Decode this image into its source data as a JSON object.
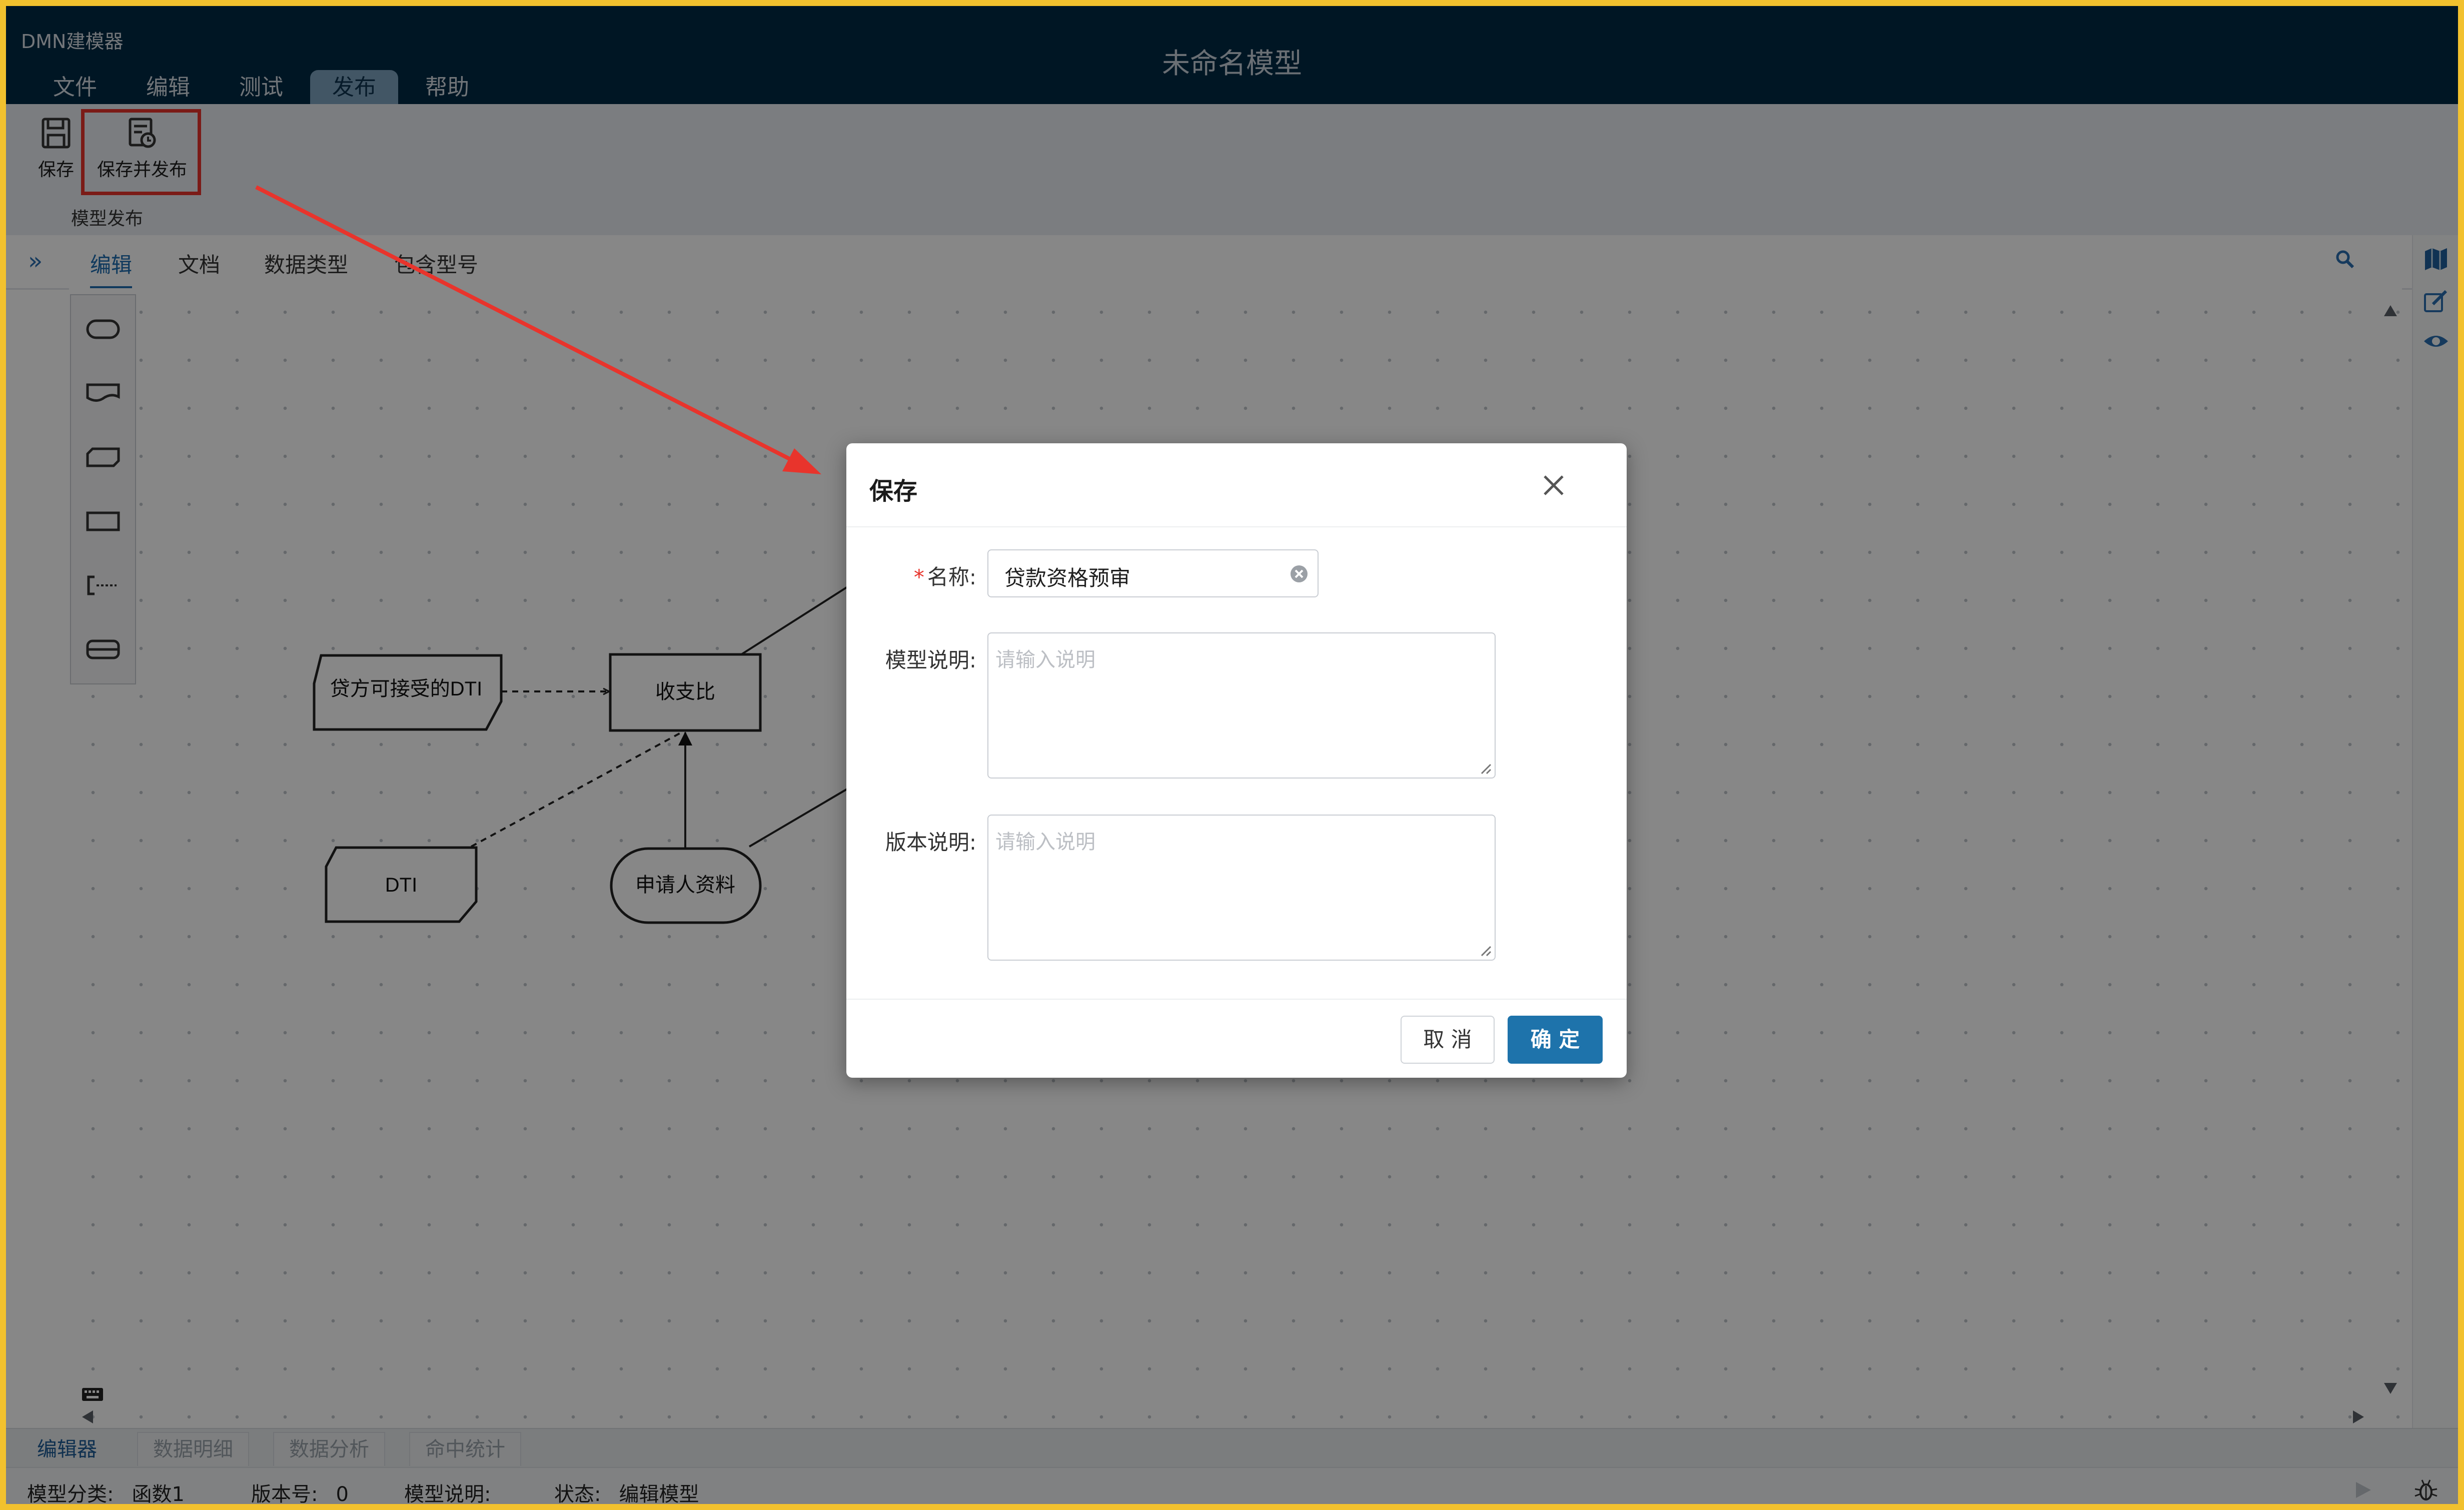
{
  "app": {
    "name": "DMN建模器",
    "window_title": "未命名模型"
  },
  "menu": [
    "文件",
    "编辑",
    "测试",
    "发布",
    "帮助"
  ],
  "toolbar": {
    "save_label": "保存",
    "save_publish_label": "保存并发布",
    "group_label": "模型发布"
  },
  "tabs": [
    "编辑",
    "文档",
    "数据类型",
    "包含型号"
  ],
  "diagram": {
    "nodes": {
      "knowledge_source": "贷方可接受的DTI",
      "decision": "收支比",
      "input_dti": "DTI",
      "input_applicant": "申请人资料"
    }
  },
  "bottom_tabs": [
    "编辑器",
    "数据明细",
    "数据分析",
    "命中统计"
  ],
  "status": {
    "category_label": "模型分类:",
    "category_value": "函数1",
    "version_label": "版本号:",
    "version_value": "0",
    "desc_label": "模型说明:",
    "state_label": "状态:",
    "state_value": "编辑模型"
  },
  "dialog": {
    "title": "保存",
    "name_label": "名称:",
    "name_value": "贷款资格预审",
    "model_desc_label": "模型说明:",
    "model_desc_placeholder": "请输入说明",
    "version_desc_label": "版本说明:",
    "version_desc_placeholder": "请输入说明",
    "cancel_label": "取 消",
    "ok_label": "确 定"
  },
  "colors": {
    "titlebar": "#002a44",
    "highlight": "#e8342c",
    "primary": "#1e73ab",
    "frame": "#f2c12e"
  }
}
